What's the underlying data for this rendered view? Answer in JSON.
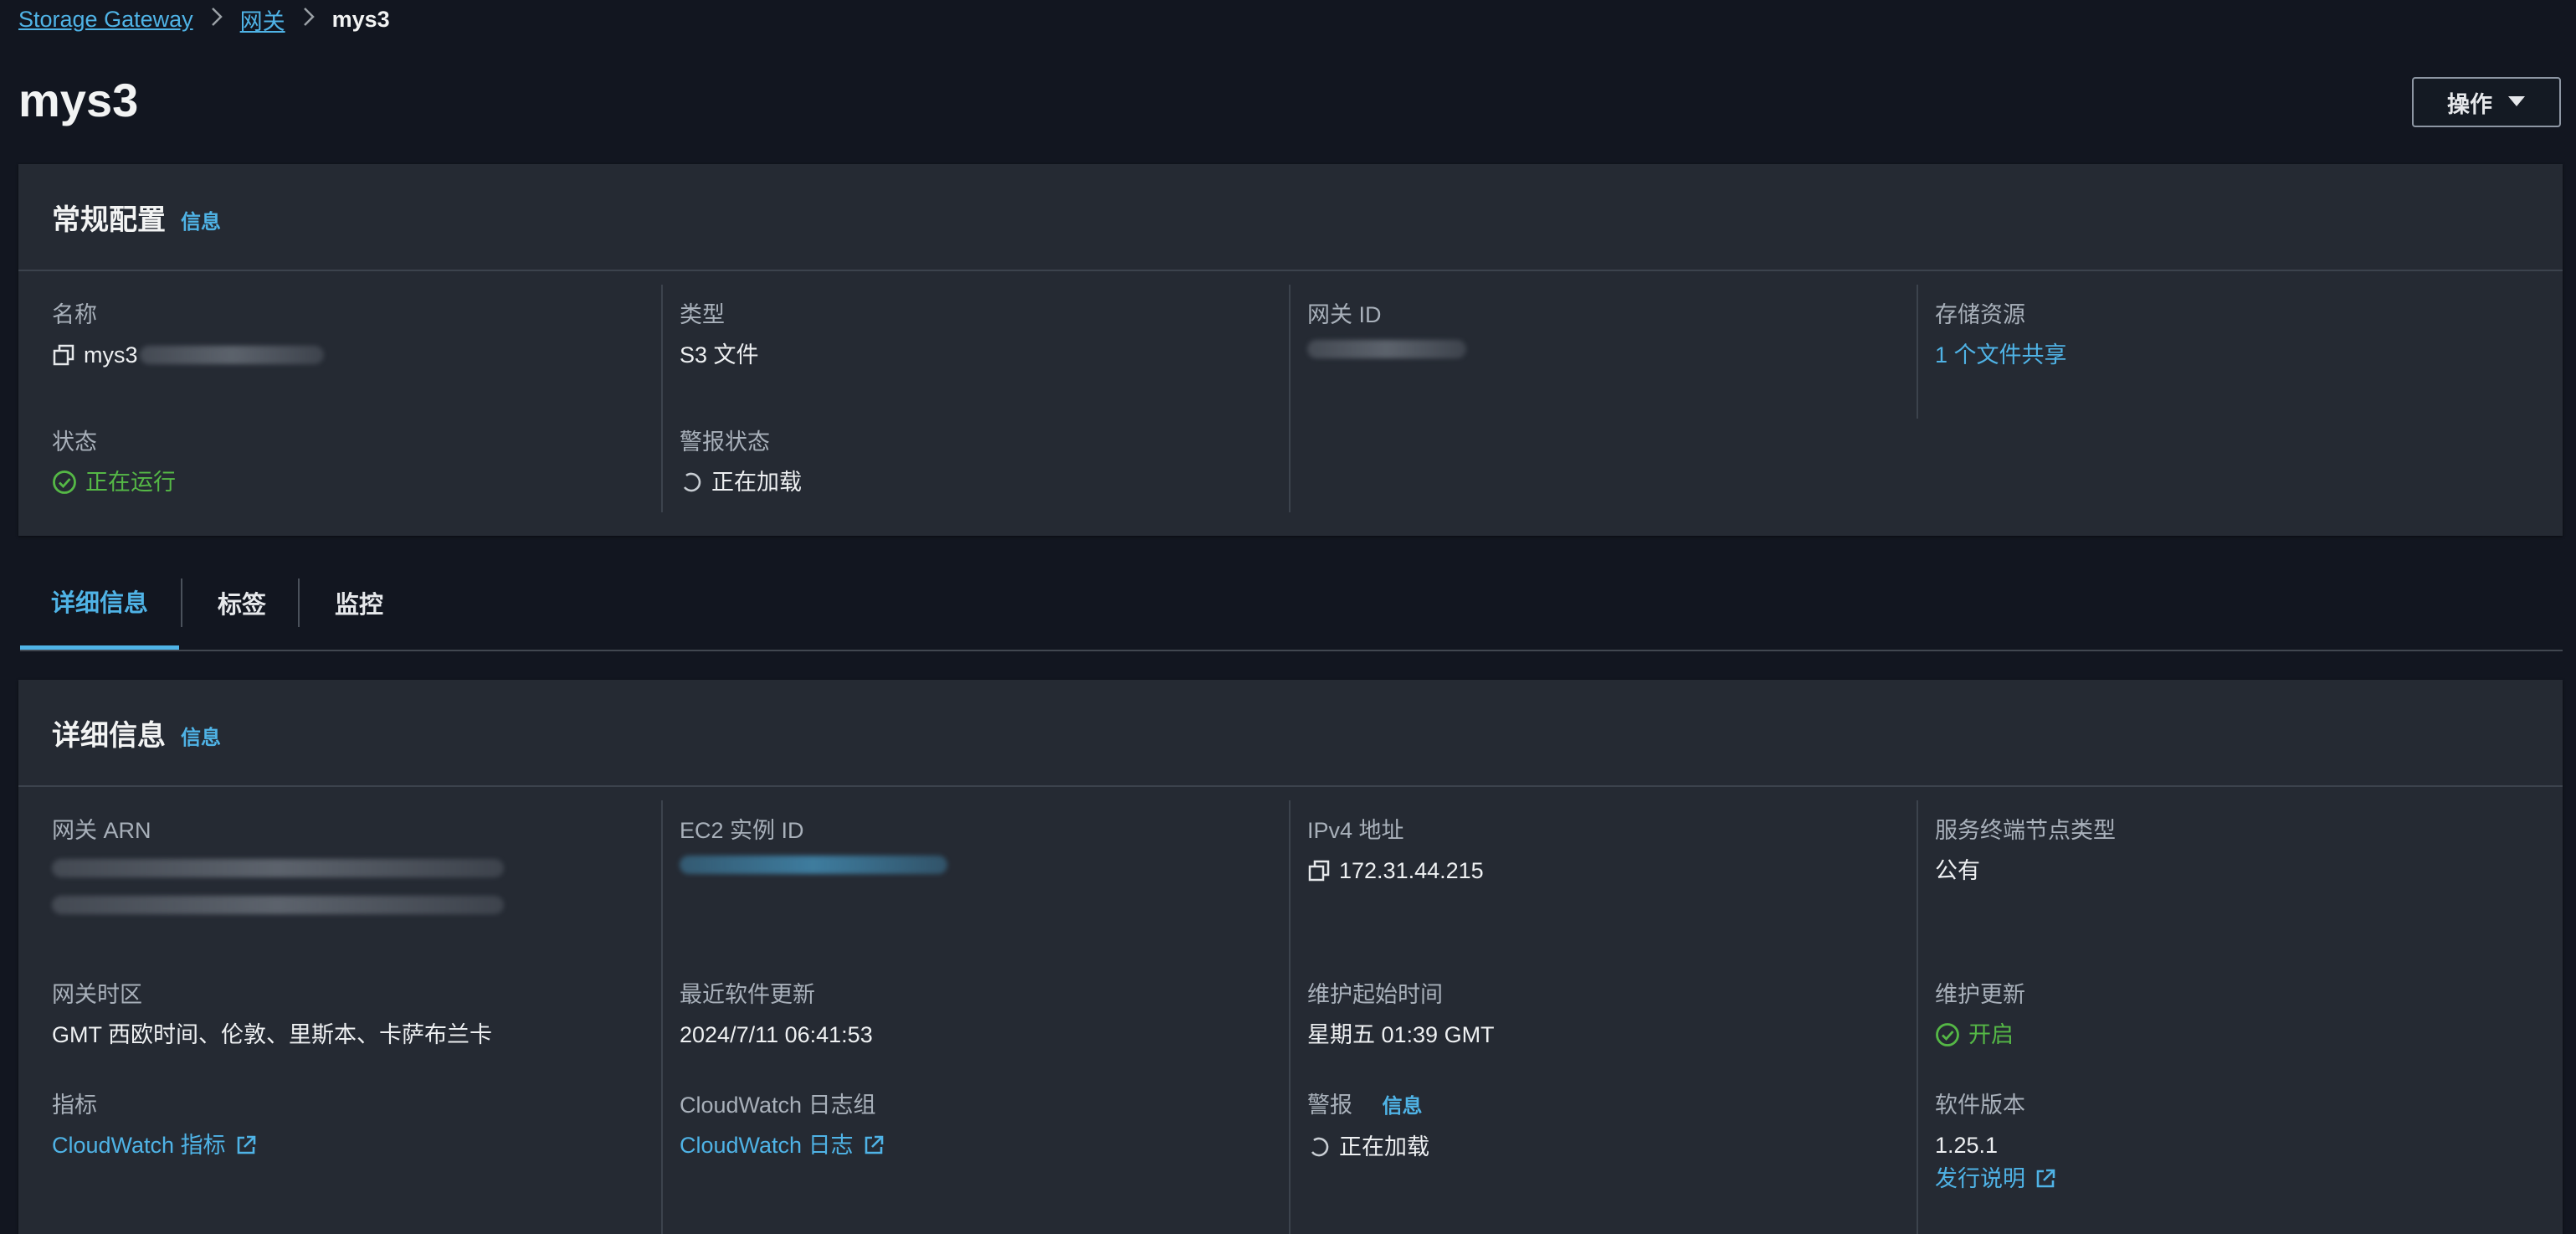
{
  "breadcrumb": {
    "root": "Storage Gateway",
    "parent": "网关",
    "current": "mys3",
    "separator": ">"
  },
  "page": {
    "title": "mys3",
    "actions_label": "操作"
  },
  "general": {
    "title": "常规配置",
    "info_label": "信息",
    "name": {
      "label": "名称",
      "value": "mys3"
    },
    "type": {
      "label": "类型",
      "value": "S3 文件"
    },
    "gateway_id": {
      "label": "网关 ID"
    },
    "storage": {
      "label": "存储资源",
      "value": "1 个文件共享"
    },
    "status": {
      "label": "状态",
      "value": "正在运行"
    },
    "alarm_status": {
      "label": "警报状态",
      "value": "正在加载"
    }
  },
  "tabs": [
    {
      "label": "详细信息",
      "active": true
    },
    {
      "label": "标签",
      "active": false
    },
    {
      "label": "监控",
      "active": false
    }
  ],
  "details": {
    "title": "详细信息",
    "info_label": "信息",
    "gateway_arn": {
      "label": "网关 ARN"
    },
    "ec2_instance": {
      "label": "EC2 实例 ID"
    },
    "ipv4": {
      "label": "IPv4 地址",
      "value": "172.31.44.215"
    },
    "endpoint_type": {
      "label": "服务终端节点类型",
      "value": "公有"
    },
    "timezone": {
      "label": "网关时区",
      "value": "GMT 西欧时间、伦敦、里斯本、卡萨布兰卡"
    },
    "last_update": {
      "label": "最近软件更新",
      "value": "2024/7/11 06:41:53"
    },
    "maintenance_start": {
      "label": "维护起始时间",
      "value": "星期五 01:39 GMT"
    },
    "maintenance_update": {
      "label": "维护更新",
      "value": "开启"
    },
    "metrics": {
      "label": "指标",
      "value": "CloudWatch 指标"
    },
    "log_group": {
      "label": "CloudWatch 日志组",
      "value": "CloudWatch 日志"
    },
    "alarms": {
      "label": "警报",
      "info_label": "信息",
      "value": "正在加载"
    },
    "software_version": {
      "label": "软件版本",
      "value": "1.25.1",
      "release_notes": "发行说明"
    }
  },
  "colors": {
    "background": "#121620",
    "panel": "#252a33",
    "link": "#4fb3e6",
    "success": "#55b846",
    "label": "#a8b0ba"
  },
  "icons": {
    "copy": "copy-icon",
    "success": "check-circle-icon",
    "loading": "spinner-icon",
    "external": "external-link-icon",
    "caret": "caret-down-icon",
    "chevron": "chevron-right-icon"
  }
}
